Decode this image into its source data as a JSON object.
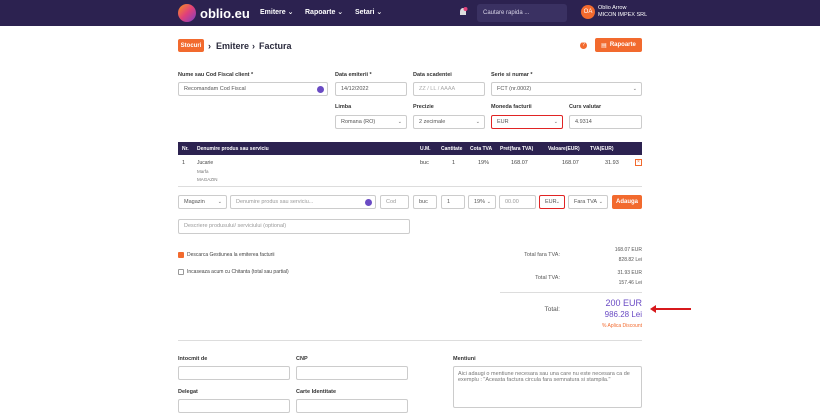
{
  "header": {
    "brand": "oblio.eu",
    "nav": [
      "Emitere",
      "Rapoarte",
      "Setari"
    ],
    "search_placeholder": "Cautare rapida ...",
    "user_initials": "OA",
    "user_name": "Oblio Arrow",
    "company": "MICON IMPEX SRL",
    "notif_count": "1"
  },
  "breadcrumb": {
    "stocuri": "Stocuri",
    "emitere": "Emitere",
    "factura": "Factura"
  },
  "rapoarte_button": "Rapoarte",
  "form": {
    "client_label": "Nume sau Cod Fiscal client *",
    "client_placeholder": "Recomandam Cod Fiscal",
    "data_emiterii_label": "Data emiterii *",
    "data_emiterii": "14/12/2022",
    "data_scadentei_label": "Data scadentei",
    "data_scadentei_placeholder": "ZZ / LL / AAAA",
    "serie_label": "Serie si numar *",
    "serie": "FCT (nr.0002)",
    "limba_label": "Limba",
    "limba": "Romana (RO)",
    "precizie_label": "Precizie",
    "precizie": "2 zecimale",
    "moneda_label": "Moneda facturii",
    "moneda": "EUR",
    "curs_label": "Curs valutar",
    "curs": "4.9314"
  },
  "table": {
    "headers": [
      "Nr.",
      "Denumire produs sau serviciu",
      "U.M.",
      "Cantitate",
      "Cota TVA",
      "Pret(fara TVA)",
      "Valoare(EUR)",
      "TVA(EUR)"
    ],
    "rows": [
      {
        "nr": "1",
        "name": "Jucarie",
        "sub1": "Marfa",
        "sub2": "MAGAZIN",
        "um": "buc",
        "qty": "1",
        "cota": "19%",
        "pret": "168.07",
        "valoare": "168.07",
        "tva": "31.93"
      }
    ]
  },
  "add_row": {
    "gestiune": "Magazin",
    "product_placeholder": "Denumire produs sau serviciu...",
    "cod_placeholder": "Cod",
    "um": "buc",
    "qty": "1",
    "cota": "19%",
    "price_placeholder": "00.00",
    "currency": "EUR",
    "tva_mode": "Fara TVA",
    "add_button": "Adauga"
  },
  "desc_placeholder": "Descriere produsului/ serviciului (optional)",
  "options": {
    "opt1": "Descarca Gestiunea la emiterea facturii",
    "opt2": "Incaseaza acum cu Chitanta (total sau partial)"
  },
  "totals": {
    "fara_tva_label": "Total fara TVA:",
    "fara_tva_eur": "168.07 EUR",
    "fara_tva_lei": "828.82 Lei",
    "tva_label": "Total TVA:",
    "tva_eur": "31.93 EUR",
    "tva_lei": "157.46 Lei",
    "total_label": "Total:",
    "total_eur": "200 EUR",
    "total_lei": "986.28 Lei",
    "discount": "% Aplica Discount"
  },
  "bottom": {
    "intocmit": "Intocmit de",
    "cnp": "CNP",
    "delegat": "Delegat",
    "carte": "Carte Identitate",
    "mentiuni": "Mentiuni",
    "mentiuni_text": "Aici adaugi o mentiune necesara sau una care nu este necesara ca de exemplu : \"Aceasta factura circula fara semnatura si stampila.\""
  }
}
